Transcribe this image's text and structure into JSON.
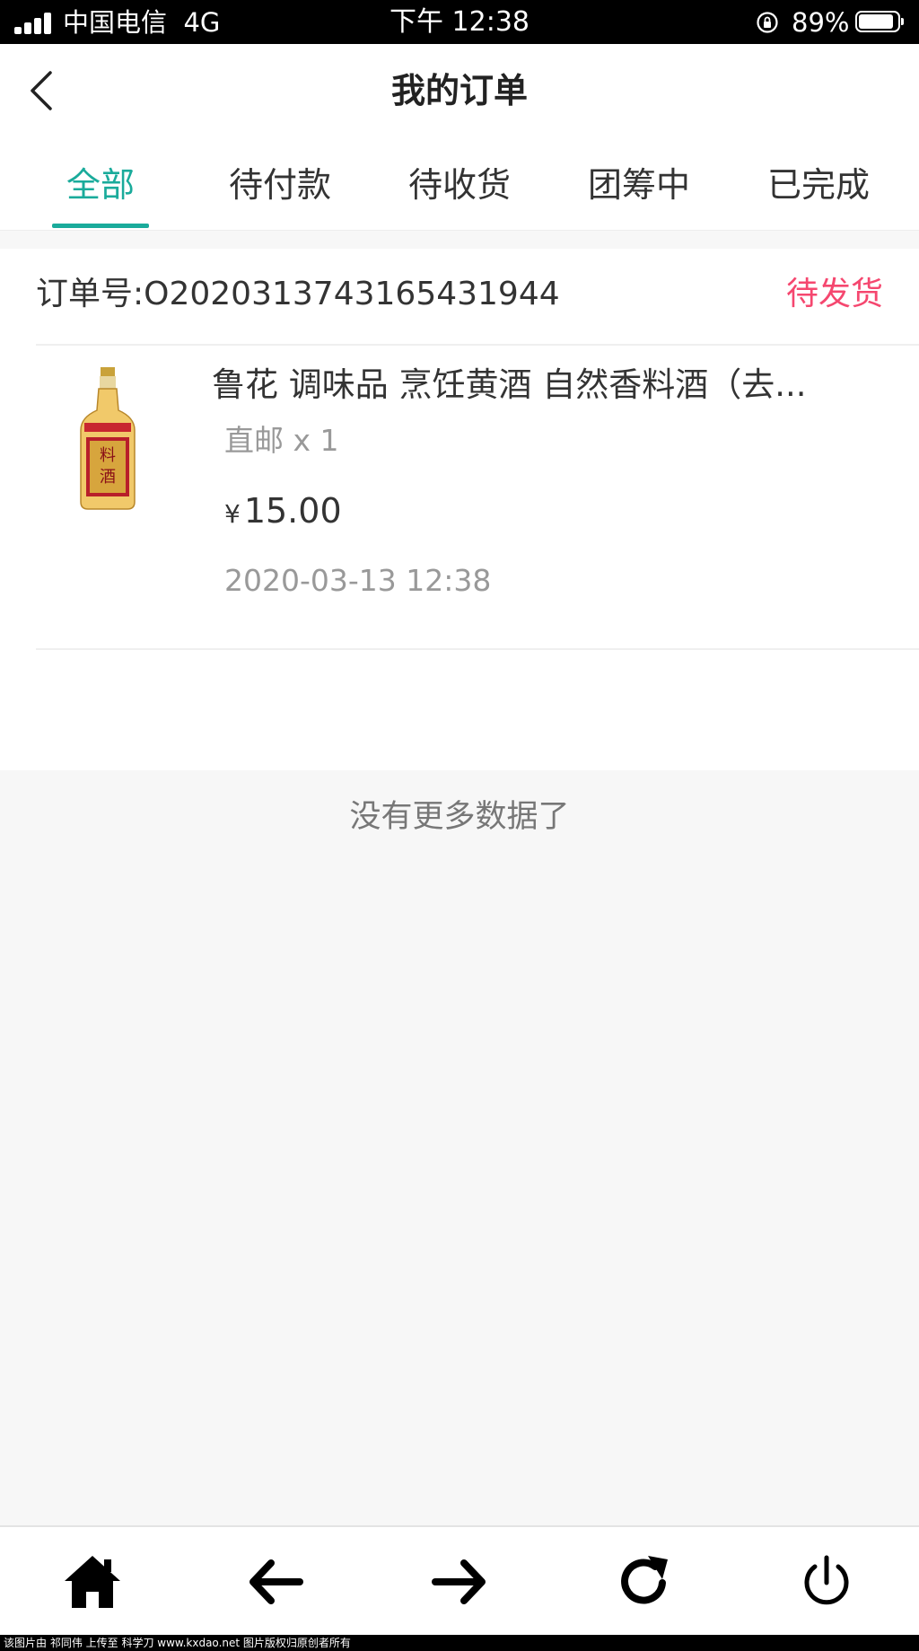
{
  "status_bar": {
    "carrier": "中国电信",
    "network": "4G",
    "time": "下午 12:38",
    "battery_percent": "89%"
  },
  "header": {
    "title": "我的订单",
    "back_icon": "chevron-left-icon"
  },
  "tabs": [
    {
      "label": "全部",
      "active": true
    },
    {
      "label": "待付款",
      "active": false
    },
    {
      "label": "待收货",
      "active": false
    },
    {
      "label": "团筹中",
      "active": false
    },
    {
      "label": "已完成",
      "active": false
    }
  ],
  "order": {
    "number": "订单号:O20203137431654319​44",
    "status": "待发货",
    "product": {
      "name": "鲁花 调味品 烹饪黄酒 自然香料酒（去...",
      "spec": "直邮 x 1",
      "currency": "¥",
      "price": "15.00",
      "image_label": "料酒"
    },
    "time": "2020-03-13 12:38"
  },
  "list_end_text": "没有更多数据了",
  "toolbar": {
    "buttons": [
      "home-icon",
      "arrow-left-icon",
      "arrow-right-icon",
      "refresh-icon",
      "power-icon"
    ]
  },
  "footer_note": "该图片由 祁同伟 上传至 科学刀 www.kxdao.net 图片版权归原创者所有",
  "colors": {
    "accent": "#1aab9b",
    "status_pink": "#f5476f"
  }
}
